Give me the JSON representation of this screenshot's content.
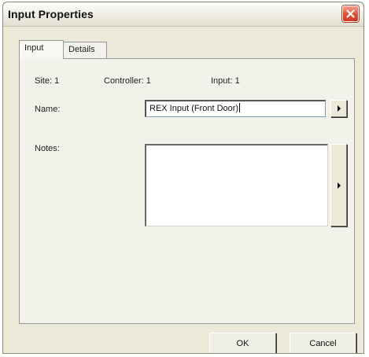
{
  "window": {
    "title": "Input Properties"
  },
  "tabs": [
    {
      "label": "Input"
    },
    {
      "label": "Details"
    }
  ],
  "info": {
    "site": "Site: 1",
    "controller": "Controller: 1",
    "input": "Input: 1"
  },
  "form": {
    "name_label": "Name:",
    "name_value": "REX Input (Front Door)",
    "notes_label": "Notes:",
    "notes_value": ""
  },
  "buttons": {
    "ok": "OK",
    "cancel": "Cancel"
  },
  "icons": {
    "close": "close-icon",
    "name_arrow": "arrow-right-icon",
    "notes_arrow": "arrow-right-icon"
  },
  "colors": {
    "close_button": "#e0553a",
    "dialog_bg": "#ece9d8"
  }
}
